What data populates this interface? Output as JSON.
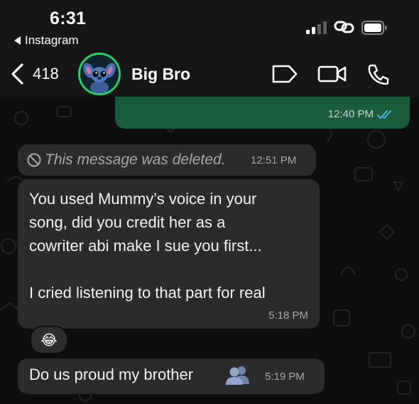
{
  "status_bar": {
    "time": "6:31",
    "back_app": "Instagram"
  },
  "header": {
    "unread_count": "418",
    "contact_name": "Big Bro",
    "avatar_icon": "stitch-avatar",
    "actions": [
      "tag-icon",
      "video-call-icon",
      "phone-icon"
    ],
    "online_ring_color": "#25d366"
  },
  "messages": [
    {
      "direction": "outgoing",
      "time": "12:40 PM",
      "status": "read",
      "status_color": "#53bdeb"
    },
    {
      "direction": "incoming",
      "deleted": true,
      "text": "This message was deleted.",
      "time": "12:51 PM"
    },
    {
      "direction": "incoming",
      "lines": [
        "You used Mummy’s voice in your",
        "song, did you credit her as a",
        "cowriter abi make I sue you first...",
        "",
        "I cried listening to that part for real"
      ],
      "time": "5:18 PM",
      "reaction": "😂"
    },
    {
      "direction": "incoming",
      "text": "Do us proud my brother",
      "emoji_icon": "busts-in-silhouette-icon",
      "time": "5:19 PM"
    }
  ],
  "colors": {
    "outgoing_bubble": "#1a5c3c",
    "incoming_bubble": "#2b2b2b",
    "background": "#0e0e0e"
  }
}
